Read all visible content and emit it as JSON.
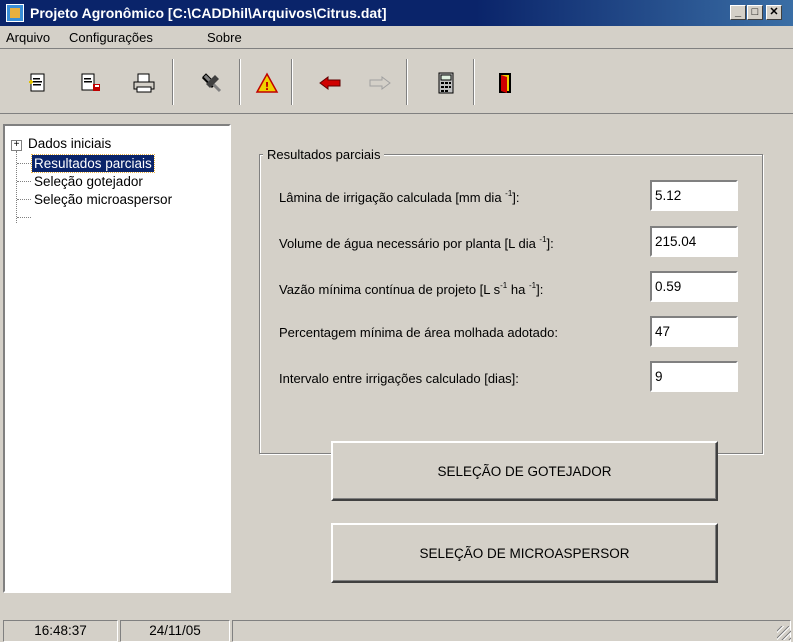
{
  "window": {
    "title": "Projeto Agronômico [C:\\CADDhil\\Arquivos\\Citrus.dat]",
    "minimize": "_",
    "maximize": "□",
    "close": "✕"
  },
  "menu": [
    {
      "label": "Arquivo"
    },
    {
      "label": "Configurações"
    },
    {
      "label": "Sobre"
    }
  ],
  "toolbar": {
    "icons": [
      "new-document-icon",
      "save-document-icon",
      "print-icon",
      "tools-icon",
      "warning-icon",
      "back-arrow-icon",
      "forward-arrow-icon",
      "calculator-icon",
      "exit-door-icon"
    ]
  },
  "tree": {
    "expander": "+",
    "items": [
      {
        "label": "Dados iniciais"
      },
      {
        "label": "Resultados parciais",
        "selected": true
      },
      {
        "label": "Seleção gotejador"
      },
      {
        "label": "Seleção microaspersor"
      }
    ]
  },
  "group": {
    "title": "Resultados parciais",
    "fields": [
      {
        "label_pre": "Lâmina de irrigação calculada [mm dia ",
        "sup1": "-1",
        "label_mid": "",
        "sup2": "",
        "label_post": "]:",
        "value": "5.12"
      },
      {
        "label_pre": "Volume de água necessário por planta [L dia ",
        "sup1": "-1",
        "label_mid": "",
        "sup2": "",
        "label_post": "]:",
        "value": "215.04"
      },
      {
        "label_pre": "Vazão mínima contínua de projeto [L s",
        "sup1": "-1",
        "label_mid": " ha ",
        "sup2": "-1",
        "label_post": "]:",
        "value": "0.59"
      },
      {
        "label_pre": "Percentagem mínima de área molhada adotado:",
        "sup1": "",
        "label_mid": "",
        "sup2": "",
        "label_post": "",
        "value": "47"
      },
      {
        "label_pre": "Intervalo entre irrigações calculado [dias]:",
        "sup1": "",
        "label_mid": "",
        "sup2": "",
        "label_post": "",
        "value": "9"
      }
    ]
  },
  "buttons": {
    "gotejador": "SELEÇÃO DE GOTEJADOR",
    "microaspersor": "SELEÇÃO DE MICROASPERSOR"
  },
  "status": {
    "time": "16:48:37",
    "date": "24/11/05"
  }
}
